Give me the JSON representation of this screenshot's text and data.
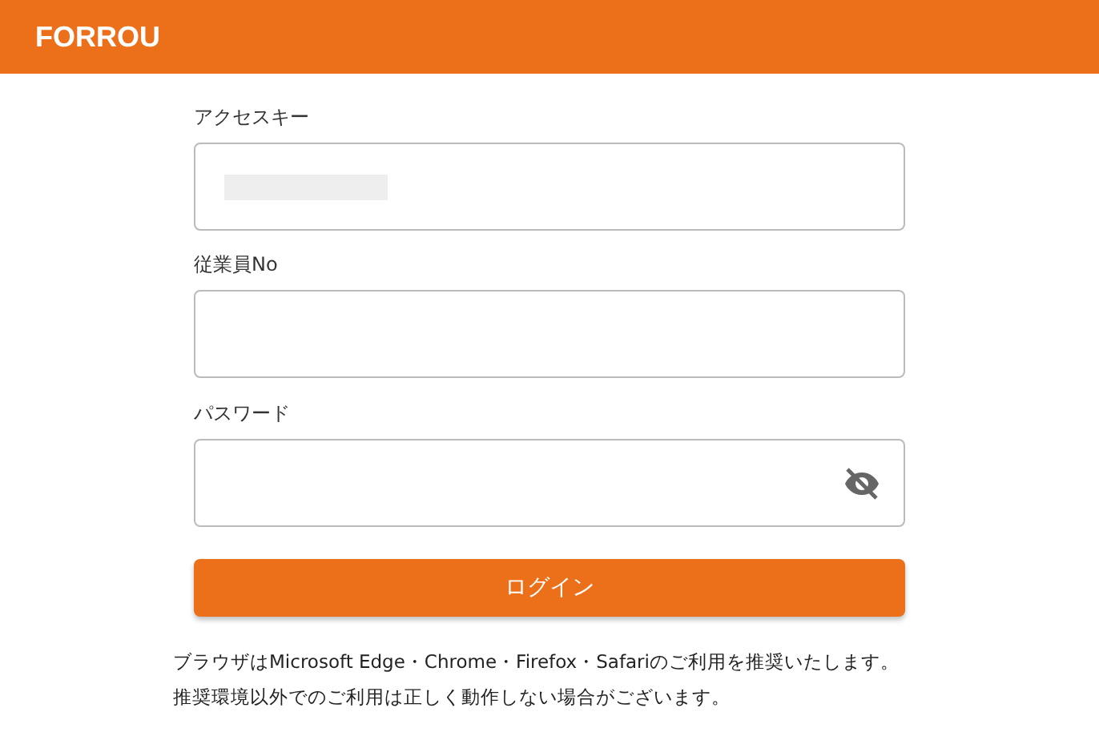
{
  "header": {
    "logo": "FORROU"
  },
  "fields": [
    {
      "kind": "blurred",
      "label": "アクセスキー"
    },
    {
      "kind": "text",
      "label": "従業員No"
    },
    {
      "kind": "password",
      "label": "パスワード",
      "visible": false
    }
  ],
  "login_button": "ログイン",
  "notice": [
    "ブラウザはMicrosoft Edge・Chrome・Firefox・Safariのご利用を推奨いたします。",
    "推奨環境以外でのご利用は正しく動作しない場合がございます。"
  ]
}
